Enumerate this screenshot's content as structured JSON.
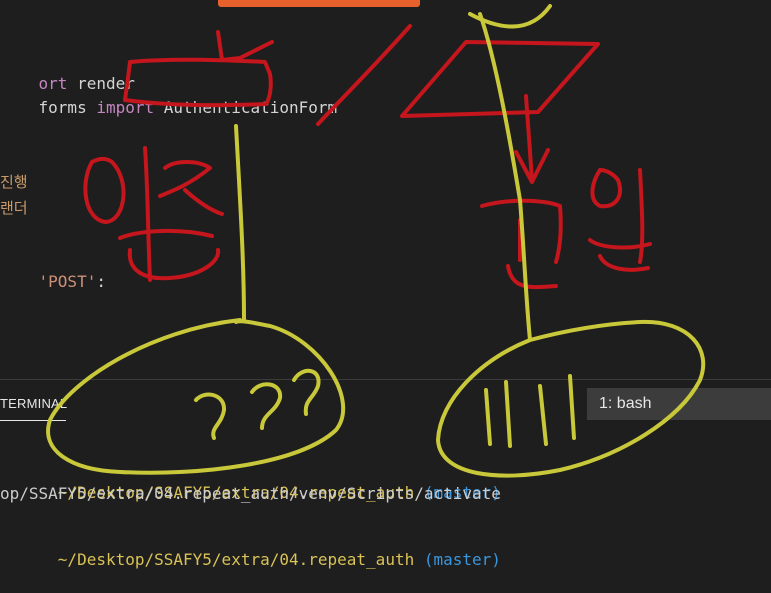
{
  "editor": {
    "line1": {
      "kw": "ort",
      "rest": " render"
    },
    "line2": {
      "mod": "forms",
      "kw": "import",
      "name": "AuthenticationForm"
    },
    "comment1": "진행",
    "comment2": "랜더",
    "string_line": {
      "str": "'POST'",
      "rest": ":"
    }
  },
  "panel": {
    "active_tab": "TERMINAL",
    "terminal_selector": "1: bash"
  },
  "terminal": {
    "prompt1_path": "~/Desktop/SSAFY5/extra/04.repeat_auth",
    "prompt1_branch": "(master)",
    "command_output": "op/SSAFY5/extra/04.repeat_auth/venv/Scripts/activate",
    "prompt2_path": "~/Desktop/SSAFY5/extra/04.repeat_auth",
    "prompt2_branch": "(master)"
  },
  "colors": {
    "annotation_red": "#c4161c",
    "annotation_yellow": "#c8c83a",
    "accent_orange": "#e8612c"
  }
}
